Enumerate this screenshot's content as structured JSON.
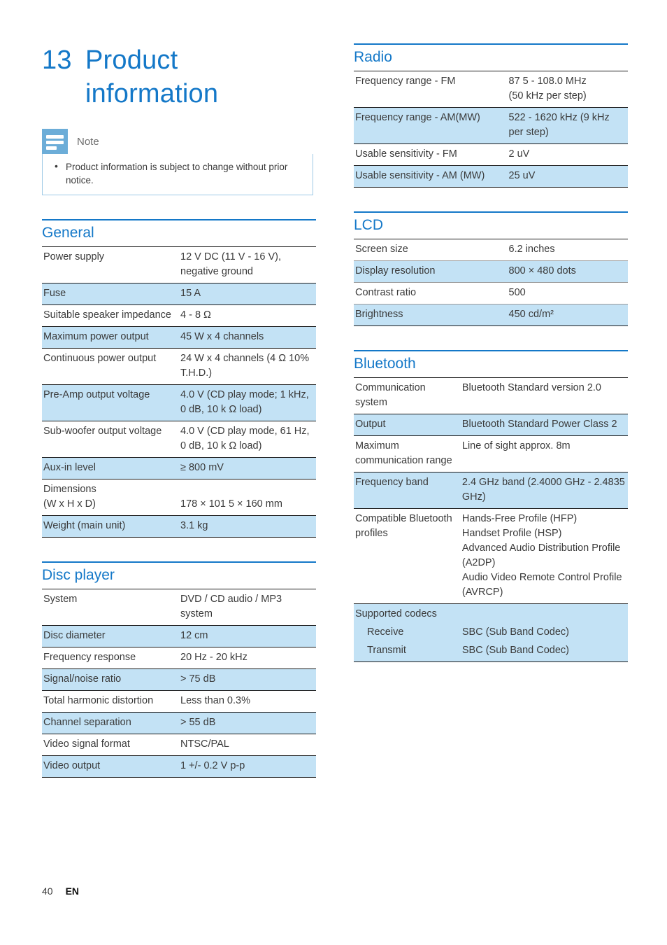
{
  "colors": {
    "heading_blue": "#1478c8",
    "row_shade": "#c3e2f5",
    "note_icon_blue": "#6cadd8",
    "body_text": "#3a3a3a"
  },
  "chapter": {
    "number": "13",
    "title": "Product information"
  },
  "note": {
    "icon": "note-icon",
    "label": "Note",
    "items": [
      "Product information is subject to change without prior notice."
    ]
  },
  "sections": {
    "general": {
      "heading": "General",
      "rows": [
        {
          "key": "Power supply",
          "value": "12 V DC (11 V - 16 V),\nnegative ground"
        },
        {
          "key": "Fuse",
          "value": "15 A"
        },
        {
          "key": "Suitable speaker impedance",
          "value": "4 - 8 Ω"
        },
        {
          "key": "Maximum power output",
          "value": "45 W x 4 channels"
        },
        {
          "key": "Continuous power output",
          "value": "24 W x 4 channels (4 Ω 10% T.H.D.)"
        },
        {
          "key": "Pre-Amp output voltage",
          "value": "4.0 V (CD play mode; 1 kHz, 0 dB, 10 k Ω load)"
        },
        {
          "key": "Sub-woofer output voltage",
          "value": "4.0 V (CD play mode, 61 Hz, 0 dB, 10 k Ω load)"
        },
        {
          "key": "Aux-in level",
          "value": "≥ 800 mV"
        },
        {
          "key": "Dimensions\n (W x H x D)",
          "value": "178 × 101 5 × 160 mm"
        },
        {
          "key": "Weight (main unit)",
          "value": "3.1 kg"
        }
      ]
    },
    "disc_player": {
      "heading": "Disc player",
      "rows": [
        {
          "key": "System",
          "value": "DVD / CD audio / MP3 system"
        },
        {
          "key": "Disc diameter",
          "value": "12 cm"
        },
        {
          "key": "Frequency response",
          "value": "20 Hz - 20 kHz"
        },
        {
          "key": "Signal/noise ratio",
          "value": "> 75 dB"
        },
        {
          "key": "Total harmonic distortion",
          "value": "Less than 0.3%"
        },
        {
          "key": "Channel separation",
          "value": "> 55 dB"
        },
        {
          "key": "Video signal format",
          "value": "NTSC/PAL"
        },
        {
          "key": "Video output",
          "value": "1 +/- 0.2 V p-p"
        }
      ]
    },
    "radio": {
      "heading": "Radio",
      "rows": [
        {
          "key": "Frequency range - FM",
          "value": "87 5 - 108.0 MHz\n(50 kHz per step)"
        },
        {
          "key": "Frequency range - AM(MW)",
          "value": "522 - 1620 kHz (9 kHz per step)"
        },
        {
          "key": "Usable sensitivity - FM",
          "value": "2 uV"
        },
        {
          "key": "Usable sensitivity - AM (MW)",
          "value": "25 uV"
        }
      ]
    },
    "lcd": {
      "heading": "LCD",
      "rows": [
        {
          "key": "Screen size",
          "value": "6.2 inches"
        },
        {
          "key": "Display resolution",
          "value": "800 × 480 dots"
        },
        {
          "key": "Contrast ratio",
          "value": "500"
        },
        {
          "key": "Brightness",
          "value": "450 cd/m²"
        }
      ]
    },
    "bluetooth": {
      "heading": "Bluetooth",
      "rows": [
        {
          "key": "Communication system",
          "value": "Bluetooth Standard version 2.0"
        },
        {
          "key": "Output",
          "value": "Bluetooth Standard Power Class 2"
        },
        {
          "key": "Maximum communication range",
          "value": "Line of sight approx. 8m"
        },
        {
          "key": "Frequency band",
          "value": "2.4 GHz band (2.4000 GHz - 2.4835 GHz)"
        },
        {
          "key": "Compatible Bluetooth profiles",
          "value": "Hands-Free Profile (HFP)\nHandset Profile (HSP)\nAdvanced Audio Distribution Profile (A2DP)\nAudio Video Remote Control Profile (AVRCP)"
        },
        {
          "key": "Supported codecs",
          "value": ""
        },
        {
          "key": "Receive",
          "value": "SBC (Sub Band Codec)"
        },
        {
          "key": "Transmit",
          "value": "SBC (Sub Band Codec)"
        }
      ]
    }
  },
  "footer": {
    "page_number": "40",
    "language": "EN"
  }
}
